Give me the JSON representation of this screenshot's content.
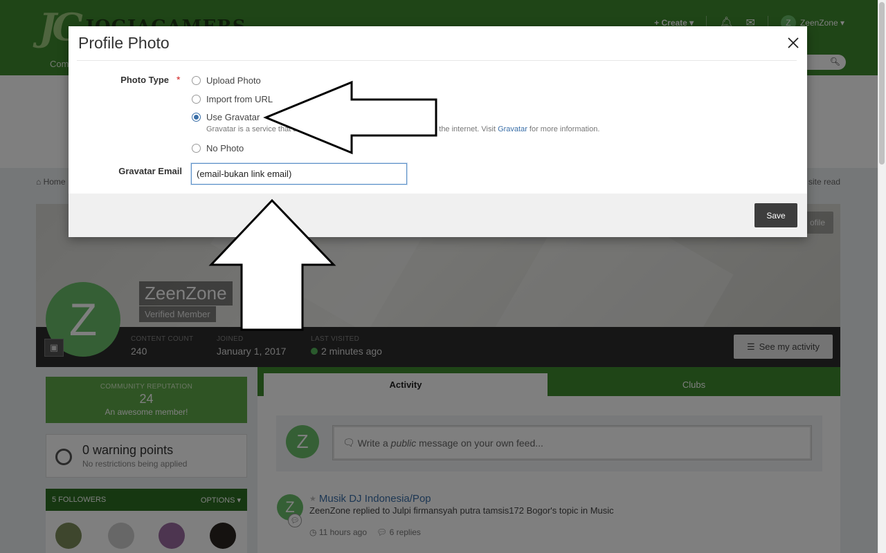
{
  "site": {
    "logo_mark": "JG",
    "logo_text": "JOGJAGAMERS",
    "nav_first": "Com"
  },
  "userbar": {
    "create": "+ Create ▾",
    "avatar_letter": "Z",
    "username": "ZeenZone ▾"
  },
  "breadcrumb": {
    "home": "⌂ Home",
    "mark_read": "site read"
  },
  "profile": {
    "name": "ZeenZone",
    "group": "Verified Member",
    "avatar_letter": "Z",
    "edit_button": "ofile",
    "stats": [
      {
        "label": "CONTENT COUNT",
        "value": "240"
      },
      {
        "label": "JOINED",
        "value": "January 1, 2017"
      },
      {
        "label": "LAST VISITED",
        "value": "2 minutes ago"
      }
    ],
    "see_activity": "See my activity"
  },
  "sidebar": {
    "reputation_title": "COMMUNITY REPUTATION",
    "reputation_value": "24",
    "reputation_text": "An awesome member!",
    "warning_title": "0 warning points",
    "warning_sub": "No restrictions being applied",
    "followers_title": "5 FOLLOWERS",
    "followers_options": "OPTIONS ▾"
  },
  "tabs": {
    "activity": "Activity",
    "clubs": "Clubs"
  },
  "feed": {
    "placeholder_prefix": "Write a ",
    "placeholder_em": "public",
    "placeholder_suffix": " message on your own feed...",
    "item_title": "Musik DJ Indonesia/Pop",
    "item_sub": "ZeenZone replied to Julpi firmansyah putra tamsis172 Bogor's topic in Music",
    "item_time": "11 hours ago",
    "item_replies": "6 replies"
  },
  "modal": {
    "title": "Profile Photo",
    "photo_type_label": "Photo Type",
    "required_mark": "*",
    "options": [
      {
        "label": "Upload Photo",
        "checked": false
      },
      {
        "label": "Import from URL",
        "checked": false
      },
      {
        "label": "Use Gravatar",
        "checked": true
      },
      {
        "label": "No Photo",
        "checked": false
      }
    ],
    "gravatar_desc_prefix": "Gravatar is a service that allows users to use the same photo across the internet. Visit ",
    "gravatar_link": "Gravatar",
    "gravatar_desc_suffix": " for more information.",
    "email_label": "Gravatar Email",
    "email_value": "(email-bukan link email)",
    "save_label": "Save"
  },
  "colors": {
    "brand_green": "#3f8a2e",
    "link_blue": "#3a6fa8",
    "avatar_green": "#6bbf6a"
  }
}
